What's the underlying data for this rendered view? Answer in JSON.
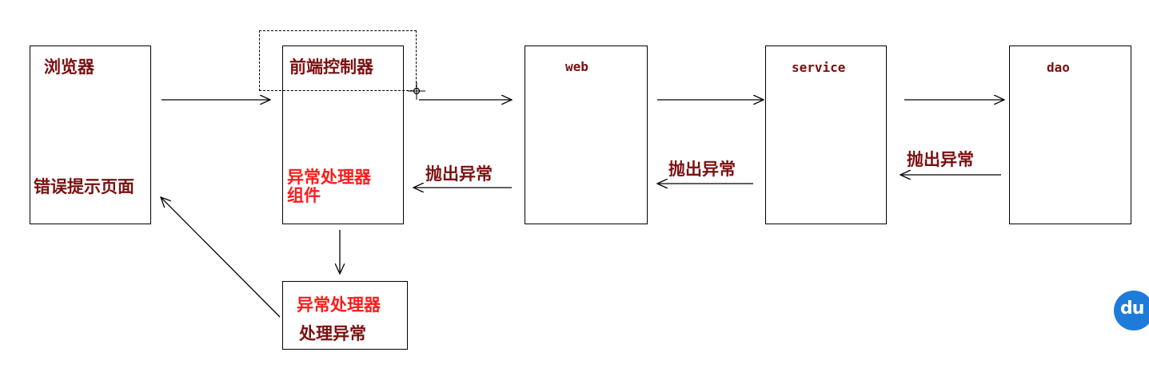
{
  "nodes": {
    "browser": {
      "title": "浏览器",
      "error_page": "错误提示页面"
    },
    "front_controller": {
      "title": "前端控制器",
      "handler_component_line1": "异常处理器",
      "handler_component_line2": "组件"
    },
    "web": {
      "title": "web"
    },
    "service": {
      "title": "service"
    },
    "dao": {
      "title": "dao"
    },
    "exception_handler": {
      "line1": "异常处理器",
      "line2": "处理异常"
    }
  },
  "edges": {
    "throw_web_to_controller": "抛出异常",
    "throw_service_to_web": "抛出异常",
    "throw_dao_to_service": "抛出异常"
  },
  "watermark": {
    "text": "du"
  },
  "colors": {
    "dark_label": "#7a0f0f",
    "red_label": "#ff1a1a",
    "watermark": "#1e7bd9"
  }
}
